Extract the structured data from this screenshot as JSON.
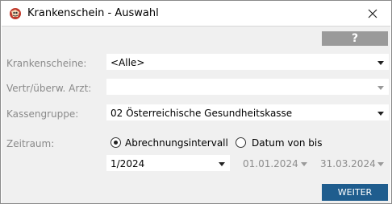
{
  "window": {
    "title": "Krankenschein - Auswahl"
  },
  "toolbar": {
    "help_label": "?"
  },
  "form": {
    "krankenscheine": {
      "label": "Krankenscheine:",
      "value": "<Alle>"
    },
    "arzt": {
      "label": "Vertr/überw. Arzt:",
      "value": ""
    },
    "kassengruppe": {
      "label": "Kassengruppe:",
      "value": "02  Österreichische Gesundheitskasse"
    },
    "zeitraum": {
      "label": "Zeitraum:",
      "options": [
        {
          "label": "Abrechnungsintervall",
          "checked": true
        },
        {
          "label": "Datum von bis",
          "checked": false
        }
      ],
      "interval_value": "1/2024",
      "date_from": "01.01.2024",
      "date_to": "31.03.2024"
    }
  },
  "footer": {
    "next_label": "WEITER"
  },
  "colors": {
    "primary_button": "#1f5d8e",
    "help_button": "#9a9a9a",
    "panel_bg": "#f0f0f0"
  }
}
